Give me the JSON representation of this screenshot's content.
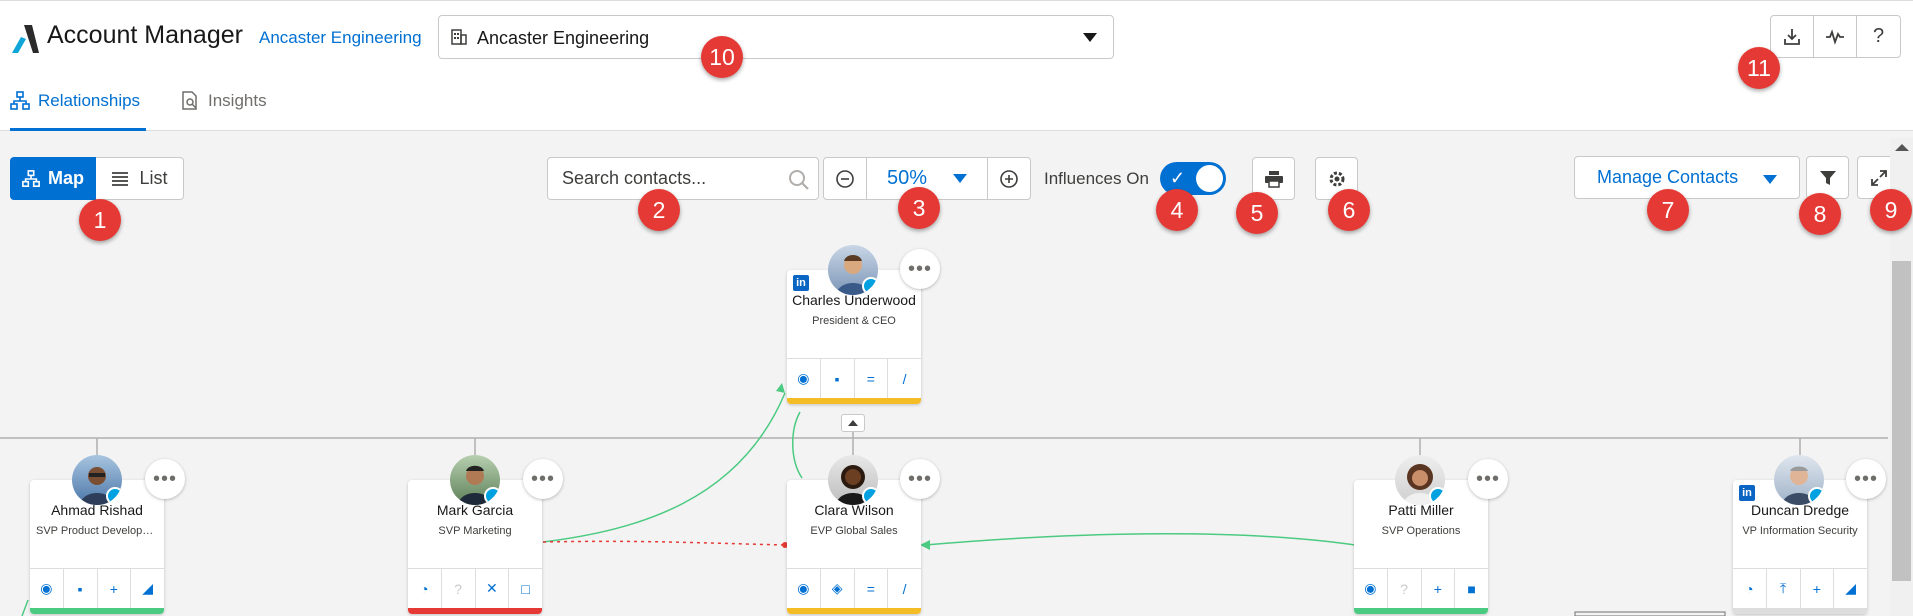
{
  "header": {
    "app_title": "Account Manager",
    "account_link": "Ancaster Engineering",
    "account_select_value": "Ancaster Engineering",
    "right_buttons": [
      "download-icon",
      "activity-icon",
      "help-icon"
    ],
    "help_label": "?"
  },
  "tabs": [
    {
      "label": "Relationships",
      "icon": "hierarchy-icon",
      "active": true
    },
    {
      "label": "Insights",
      "icon": "report-icon",
      "active": false
    }
  ],
  "toolbar": {
    "view_map": "Map",
    "view_list": "List",
    "search_placeholder": "Search contacts...",
    "zoom_value": "50%",
    "influences_label": "Influences On",
    "manage_contacts": "Manage Contacts"
  },
  "annotations": [
    "1",
    "2",
    "3",
    "4",
    "5",
    "6",
    "7",
    "8",
    "9",
    "10",
    "11"
  ],
  "contacts": [
    {
      "name": "Charles Underwood",
      "title": "President & CEO",
      "strip": "#f4bc25",
      "icons": [
        "◉",
        "▪",
        "=",
        "/"
      ],
      "linkedin": true
    },
    {
      "name": "Ahmad Rishad",
      "title": "SVP Product Developm...",
      "strip": "#4bca81",
      "icons": [
        "◉",
        "▪",
        "+",
        "◢"
      ],
      "linkedin": false
    },
    {
      "name": "Mark Garcia",
      "title": "SVP Marketing",
      "strip": "#e53935",
      "icons": [
        "◔",
        "?",
        "✕",
        "□"
      ],
      "linkedin": false
    },
    {
      "name": "Clara Wilson",
      "title": "EVP Global Sales",
      "strip": "#f4bc25",
      "icons": [
        "◉",
        "◈",
        "=",
        "/"
      ],
      "linkedin": false
    },
    {
      "name": "Patti Miller",
      "title": "SVP Operations",
      "strip": "#4bca81",
      "icons": [
        "◉",
        "?",
        "+",
        "■"
      ],
      "linkedin": false
    },
    {
      "name": "Duncan Dredge",
      "title": "VP Information Security",
      "strip": "#dddddd",
      "icons": [
        "◔",
        "⤒",
        "+",
        "◢"
      ],
      "linkedin": true
    }
  ],
  "colors": {
    "accent": "#0070d2",
    "badge": "#e53935",
    "positive": "#4bca81",
    "negative": "#e53935"
  }
}
